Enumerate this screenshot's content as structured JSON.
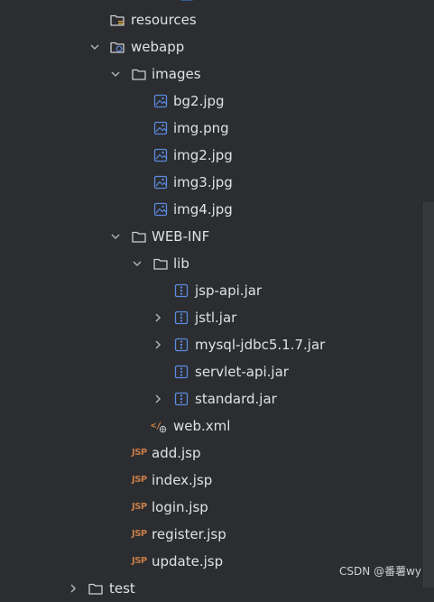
{
  "tree": {
    "resources": "resources",
    "webapp": "webapp",
    "images": "images",
    "bg2": "bg2.jpg",
    "img": "img.png",
    "img2": "img2.jpg",
    "img3": "img3.jpg",
    "img4": "img4.jpg",
    "webinf": "WEB-INF",
    "lib": "lib",
    "jspapi": "jsp-api.jar",
    "jstl": "jstl.jar",
    "mysql": "mysql-jdbc5.1.7.jar",
    "servlet": "servlet-api.jar",
    "standard": "standard.jar",
    "webxml": "web.xml",
    "add": "add.jsp",
    "index": "index.jsp",
    "login": "login.jsp",
    "register": "register.jsp",
    "update": "update.jsp",
    "test": "test"
  },
  "icons": {
    "jsp_badge": "JSP",
    "xml_badge": "</"
  },
  "watermark": "CSDN @番薯wy"
}
